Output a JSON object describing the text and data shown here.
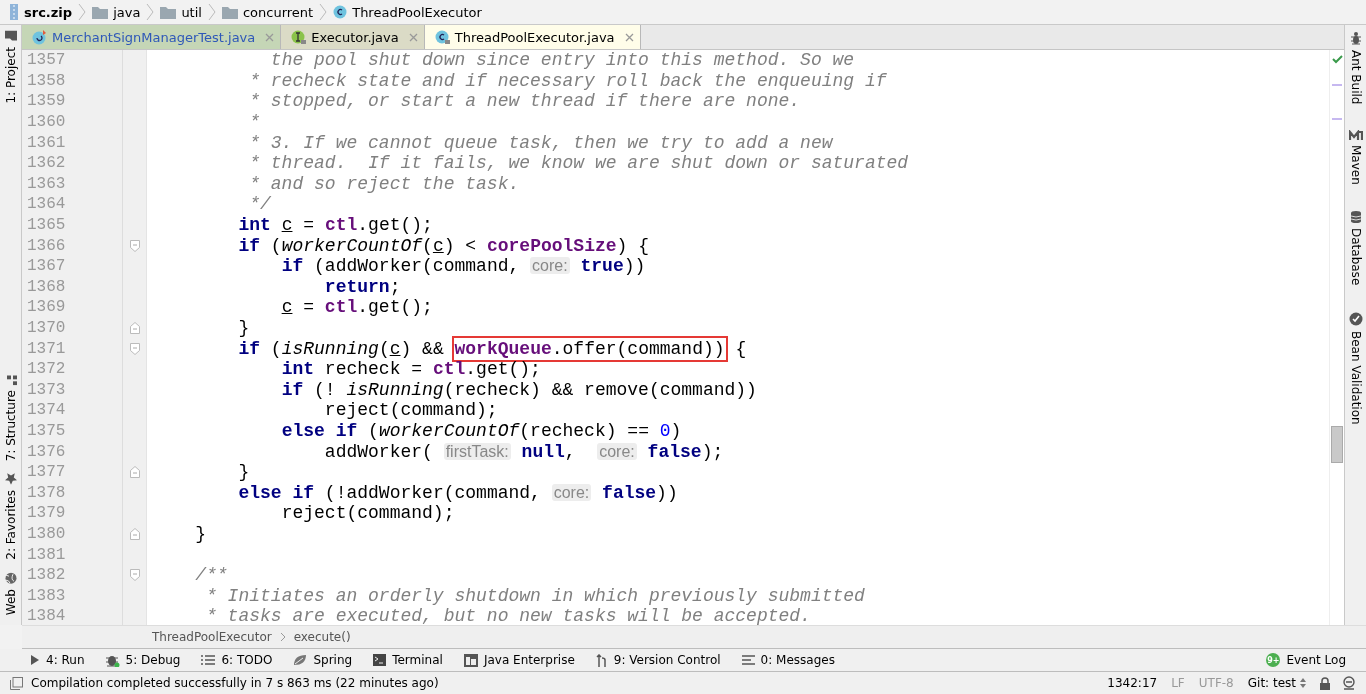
{
  "breadcrumb": [
    {
      "label": "src.zip",
      "kind": "archive"
    },
    {
      "label": "java",
      "kind": "folder"
    },
    {
      "label": "util",
      "kind": "folder"
    },
    {
      "label": "concurrent",
      "kind": "folder"
    },
    {
      "label": "ThreadPoolExecutor",
      "kind": "class"
    }
  ],
  "tabs": [
    {
      "label": "MerchantSignManagerTest.java",
      "kind": "test",
      "color": "#c5d6b6",
      "selected": false
    },
    {
      "label": "Executor.java",
      "kind": "interface",
      "color": "#dbdbc6",
      "selected": false
    },
    {
      "label": "ThreadPoolExecutor.java",
      "kind": "class",
      "selected": true
    }
  ],
  "left_tools": [
    {
      "label": "1: Project",
      "kind": "folder"
    },
    {
      "label": "7: Structure",
      "kind": "structure"
    },
    {
      "label": "2: Favorites",
      "kind": "star"
    },
    {
      "label": "Web",
      "kind": "globe"
    }
  ],
  "right_tools": [
    {
      "label": "Ant Build",
      "kind": "ant"
    },
    {
      "label": "Maven",
      "kind": "maven"
    },
    {
      "label": "Database",
      "kind": "database"
    },
    {
      "label": "Bean Validation",
      "kind": "bean"
    }
  ],
  "editor": {
    "lines": [
      {
        "number": "1357",
        "segs": [
          {
            "kind": "comment",
            "text": "           the pool shut down since entry into this method. So we"
          }
        ]
      },
      {
        "number": "1358",
        "segs": [
          {
            "kind": "comment",
            "text": "         * recheck state and if necessary roll back the enqueuing if"
          }
        ]
      },
      {
        "number": "1359",
        "segs": [
          {
            "kind": "comment",
            "text": "         * stopped, or start a new thread if there are none."
          }
        ]
      },
      {
        "number": "1360",
        "segs": [
          {
            "kind": "comment",
            "text": "         *"
          }
        ]
      },
      {
        "number": "1361",
        "segs": [
          {
            "kind": "comment",
            "text": "         * 3. If we cannot queue task, then we try to add a new"
          }
        ]
      },
      {
        "number": "1362",
        "segs": [
          {
            "kind": "comment",
            "text": "         * thread.  If it fails, we know we are shut down or saturated"
          }
        ]
      },
      {
        "number": "1363",
        "segs": [
          {
            "kind": "comment",
            "text": "         * and so reject the task."
          }
        ]
      },
      {
        "number": "1364",
        "segs": [
          {
            "kind": "comment",
            "text": "         */"
          }
        ]
      },
      {
        "number": "1365",
        "segs": [
          {
            "kind": "keyword",
            "text": "        int "
          },
          {
            "kind": "variable",
            "text": "c"
          },
          {
            "kind": "plain",
            "text": " = "
          },
          {
            "kind": "field",
            "text": "ctl"
          },
          {
            "kind": "plain",
            "text": ".get();"
          }
        ]
      },
      {
        "number": "1366",
        "kind": "opener",
        "segs": [
          {
            "kind": "keyword",
            "text": "        if"
          },
          {
            "kind": "plain",
            "text": " ("
          },
          {
            "kind": "static",
            "text": "workerCountOf"
          },
          {
            "kind": "plain",
            "text": "("
          },
          {
            "kind": "variable",
            "text": "c"
          },
          {
            "kind": "plain",
            "text": ") < "
          },
          {
            "kind": "field",
            "text": "corePoolSize"
          },
          {
            "kind": "plain",
            "text": ") {"
          }
        ]
      },
      {
        "number": "1367",
        "segs": [
          {
            "kind": "keyword",
            "text": "            if"
          },
          {
            "kind": "plain",
            "text": " (addWorker(command, "
          },
          {
            "kind": "hint",
            "text": "core:"
          },
          {
            "kind": "keyword",
            "text": " true"
          },
          {
            "kind": "plain",
            "text": "))"
          }
        ]
      },
      {
        "number": "1368",
        "segs": [
          {
            "kind": "keyword",
            "text": "                return"
          },
          {
            "kind": "plain",
            "text": ";"
          }
        ]
      },
      {
        "number": "1369",
        "segs": [
          {
            "kind": "variable",
            "text": "            c"
          },
          {
            "kind": "plain",
            "text": " = "
          },
          {
            "kind": "field",
            "text": "ctl"
          },
          {
            "kind": "plain",
            "text": ".get();"
          }
        ]
      },
      {
        "number": "1370",
        "kind": "closer",
        "segs": [
          {
            "kind": "plain",
            "text": "        }"
          }
        ]
      },
      {
        "number": "1371",
        "kind": "opener",
        "segs": [
          {
            "kind": "keyword",
            "text": "        if"
          },
          {
            "kind": "plain",
            "text": " ("
          },
          {
            "kind": "static",
            "text": "isRunning"
          },
          {
            "kind": "plain",
            "text": "("
          },
          {
            "kind": "variable",
            "text": "c"
          },
          {
            "kind": "plain",
            "text": ") && "
          },
          {
            "kind": "box",
            "parts": [
              {
                "kind": "field",
                "text": "workQueue"
              },
              {
                "kind": "plain",
                "text": ".offer(command))"
              }
            ]
          },
          {
            "kind": "plain",
            "text": " {"
          }
        ]
      },
      {
        "number": "1372",
        "segs": [
          {
            "kind": "keyword",
            "text": "            int"
          },
          {
            "kind": "plain",
            "text": " recheck = "
          },
          {
            "kind": "field",
            "text": "ctl"
          },
          {
            "kind": "plain",
            "text": ".get();"
          }
        ]
      },
      {
        "number": "1373",
        "segs": [
          {
            "kind": "keyword",
            "text": "            if"
          },
          {
            "kind": "plain",
            "text": " (! "
          },
          {
            "kind": "static",
            "text": "isRunning"
          },
          {
            "kind": "plain",
            "text": "(recheck) && remove(command))"
          }
        ]
      },
      {
        "number": "1374",
        "segs": [
          {
            "kind": "plain",
            "text": "                reject(command);"
          }
        ]
      },
      {
        "number": "1375",
        "segs": [
          {
            "kind": "keyword",
            "text": "            else if"
          },
          {
            "kind": "plain",
            "text": " ("
          },
          {
            "kind": "static",
            "text": "workerCountOf"
          },
          {
            "kind": "plain",
            "text": "(recheck) == "
          },
          {
            "kind": "number",
            "text": "0"
          },
          {
            "kind": "plain",
            "text": ")"
          }
        ]
      },
      {
        "number": "1376",
        "segs": [
          {
            "kind": "plain",
            "text": "                addWorker( "
          },
          {
            "kind": "hint",
            "text": "firstTask:"
          },
          {
            "kind": "keyword",
            "text": " null"
          },
          {
            "kind": "plain",
            "text": ",  "
          },
          {
            "kind": "hint",
            "text": "core:"
          },
          {
            "kind": "keyword",
            "text": " false"
          },
          {
            "kind": "plain",
            "text": ");"
          }
        ]
      },
      {
        "number": "1377",
        "kind": "closer",
        "segs": [
          {
            "kind": "plain",
            "text": "        }"
          }
        ]
      },
      {
        "number": "1378",
        "segs": [
          {
            "kind": "keyword",
            "text": "        else if"
          },
          {
            "kind": "plain",
            "text": " (!addWorker(command, "
          },
          {
            "kind": "hint",
            "text": "core:"
          },
          {
            "kind": "keyword",
            "text": " false"
          },
          {
            "kind": "plain",
            "text": "))"
          }
        ]
      },
      {
        "number": "1379",
        "segs": [
          {
            "kind": "plain",
            "text": "            reject(command);"
          }
        ]
      },
      {
        "number": "1380",
        "kind": "closer",
        "segs": [
          {
            "kind": "plain",
            "text": "    }"
          }
        ]
      },
      {
        "number": "1381"
      },
      {
        "number": "1382",
        "kind": "opener",
        "segs": [
          {
            "kind": "comment",
            "text": "    /**"
          }
        ]
      },
      {
        "number": "1383",
        "segs": [
          {
            "kind": "comment",
            "text": "     * Initiates an orderly shutdown in which previously submitted"
          }
        ]
      },
      {
        "number": "1384",
        "segs": [
          {
            "kind": "comment",
            "text": "     * tasks are executed, but no new tasks will be accepted."
          }
        ]
      }
    ]
  },
  "code_breadcrumb": [
    "ThreadPoolExecutor",
    "execute()"
  ],
  "tool_windows": [
    {
      "label": "4: Run",
      "kind": "run"
    },
    {
      "label": "5: Debug",
      "kind": "debug"
    },
    {
      "label": "6: TODO",
      "kind": "todo"
    },
    {
      "label": "Spring",
      "kind": "spring"
    },
    {
      "label": "Terminal",
      "kind": "terminal"
    },
    {
      "label": "Java Enterprise",
      "kind": "enterprise"
    },
    {
      "label": "9: Version Control",
      "kind": "vcs"
    },
    {
      "label": "0: Messages",
      "kind": "messages"
    }
  ],
  "event_log": {
    "label": "Event Log",
    "badge": "9+"
  },
  "status_bar": {
    "message": "Compilation completed successfully in 7 s 863 ms (22 minutes ago)",
    "position": "1342:17",
    "line_separator": "LF",
    "encoding": "UTF-8",
    "branch": "Git: test"
  }
}
